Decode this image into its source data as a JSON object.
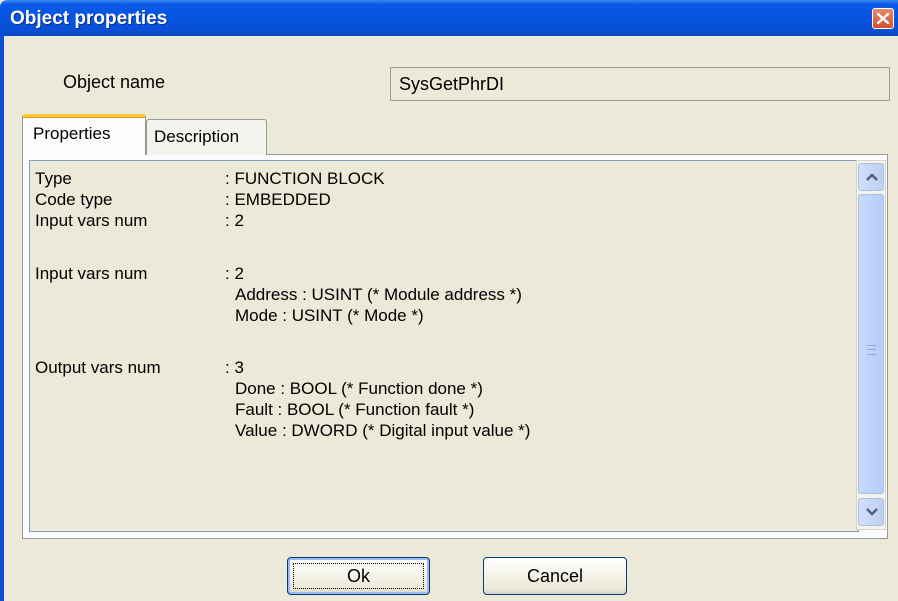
{
  "window": {
    "title": "Object properties"
  },
  "object_name": {
    "label": "Object name",
    "value": "SysGetPhrDI"
  },
  "tabs": [
    {
      "label": "Properties",
      "active": true
    },
    {
      "label": "Description",
      "active": false
    }
  ],
  "properties": {
    "rows": [
      {
        "label": "Type",
        "value": ": FUNCTION BLOCK"
      },
      {
        "label": "Code type",
        "value": ": EMBEDDED"
      },
      {
        "label": "Input vars num",
        "value": ": 2"
      },
      {
        "label": "Input vars num",
        "value": ": 2"
      },
      {
        "label": "Output vars num",
        "value": ": 3"
      }
    ],
    "input_vars": [
      "Address : USINT (* Module address *)",
      "Mode : USINT (* Mode *)"
    ],
    "output_vars": [
      "Done : BOOL (* Function done *)",
      "Fault : BOOL (* Function fault *)",
      "Value : DWORD (* Digital input value *)"
    ]
  },
  "buttons": {
    "ok": "Ok",
    "cancel": "Cancel"
  },
  "icons": {
    "close": "close-icon",
    "scroll_up": "arrow-up-icon",
    "scroll_down": "arrow-down-icon"
  },
  "colors": {
    "titlebar": "#0a5ae8",
    "close_button": "#d2502b",
    "active_tab_accent": "#ffc83c"
  }
}
